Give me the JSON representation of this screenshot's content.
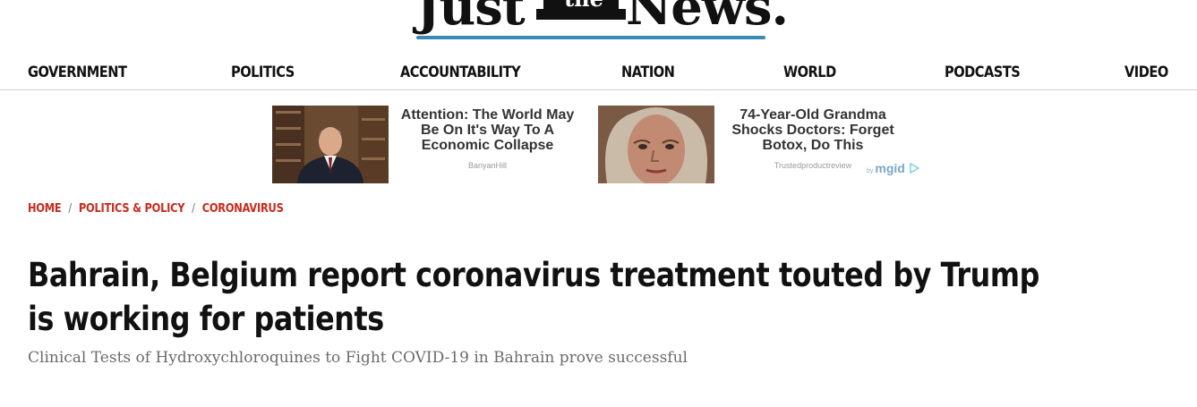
{
  "logo": {
    "word1": "Just",
    "word2": "the",
    "word3": "News.",
    "accent_color": "#3a8bb3"
  },
  "nav": {
    "items": [
      "GOVERNMENT",
      "POLITICS",
      "ACCOUNTABILITY",
      "NATION",
      "WORLD",
      "PODCASTS",
      "VIDEO"
    ]
  },
  "ads": [
    {
      "title": "Attention: The World May Be On It's Way To A Economic Collapse",
      "source": "BanyanHill",
      "image": "man-in-suit-photo"
    },
    {
      "title": "74-Year-Old Grandma Shocks Doctors: Forget Botox, Do This",
      "source": "Trustedproductreview",
      "image": "elderly-woman-photo"
    }
  ],
  "ad_network": {
    "prefix": "by",
    "name": "mgid",
    "icon": "play-triangle-icon"
  },
  "breadcrumb": {
    "items": [
      "HOME",
      "POLITICS & POLICY",
      "CORONAVIRUS"
    ],
    "separator": "/",
    "color": "#c92a1c"
  },
  "article": {
    "headline": "Bahrain, Belgium report coronavirus treatment touted by Trump is working for patients",
    "subheadline": "Clinical Tests of Hydroxychloroquines to Fight COVID-19 in Bahrain prove successful"
  }
}
